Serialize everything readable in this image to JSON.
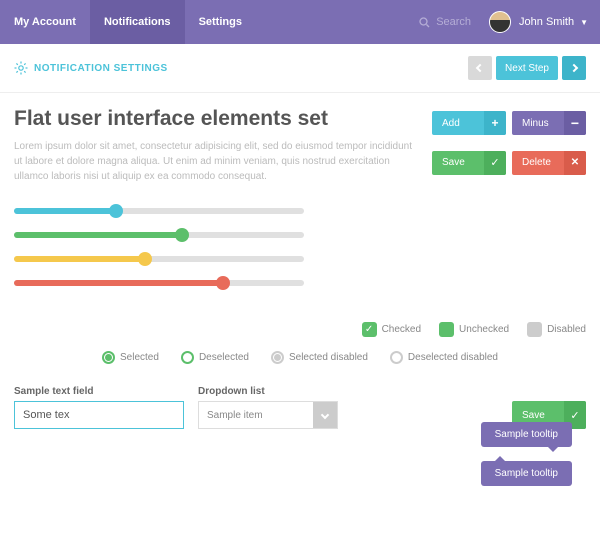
{
  "nav": {
    "items": [
      "My Account",
      "Notifications",
      "Settings"
    ],
    "search": "Search",
    "user": "John Smith"
  },
  "subheader": {
    "title": "NOTIFICATION SETTINGS",
    "next": "Next Step"
  },
  "main": {
    "heading": "Flat user interface elements set",
    "lorem": "Lorem ipsum dolor sit amet, consectetur adipisicing elit, sed do eiusmod tempor incididunt ut labore et dolore magna aliqua. Ut enim ad minim veniam, quis nostrud exercitation ullamco laboris nisi ut aliquip ex ea commodo consequat."
  },
  "buttons": {
    "add": "Add",
    "minus": "Minus",
    "save": "Save",
    "delete": "Delete"
  },
  "tooltips": {
    "t1": "Sample tooltip",
    "t2": "Sample tooltip"
  },
  "checkboxes": {
    "checked": "Checked",
    "unchecked": "Unchecked",
    "disabled": "Disabled"
  },
  "radios": {
    "selected": "Selected",
    "deselected": "Deselected",
    "sel_dis": "Selected disabled",
    "desel_dis": "Deselected disabled"
  },
  "form": {
    "text_label": "Sample text field",
    "text_value": "Some tex",
    "dd_label": "Dropdown list",
    "dd_value": "Sample item",
    "save": "Save"
  },
  "sliders": [
    35,
    58,
    45,
    72
  ]
}
